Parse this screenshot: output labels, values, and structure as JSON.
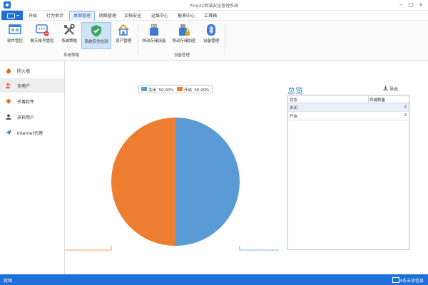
{
  "window": {
    "title": "Ping32终端安全管理系统"
  },
  "menu": {
    "tabs": [
      {
        "label": "开始"
      },
      {
        "label": "行为审计"
      },
      {
        "label": "桌面管理"
      },
      {
        "label": "网络管理"
      },
      {
        "label": "文档安全"
      },
      {
        "label": "运维中心"
      },
      {
        "label": "报表中心"
      },
      {
        "label": "工具箱"
      }
    ],
    "active_index": 2
  },
  "ribbon": {
    "groups": [
      {
        "label": "系统策略"
      },
      {
        "label": "设备管理"
      }
    ],
    "buttons": [
      {
        "label": "软件管控",
        "icon": "software-control-icon"
      },
      {
        "label": "聊天帐号管控",
        "icon": "chat-account-icon"
      },
      {
        "label": "系统策略",
        "icon": "tools-icon"
      },
      {
        "label": "系统安全检测",
        "icon": "shield-check-icon"
      },
      {
        "label": "资产管理",
        "icon": "asset-house-icon"
      },
      {
        "label": "移动存储设备",
        "icon": "usb-storage-icon"
      },
      {
        "label": "移动存储加密",
        "icon": "usb-encrypt-icon"
      },
      {
        "label": "设备管理",
        "icon": "bluetooth-device-icon"
      }
    ]
  },
  "sidebar": {
    "items": [
      {
        "label": "防火墙",
        "icon": "firewall-icon"
      },
      {
        "label": "多用户",
        "icon": "multi-user-icon"
      },
      {
        "label": "杀毒软件",
        "icon": "antivirus-icon"
      },
      {
        "label": "来宾用户",
        "icon": "guest-user-icon"
      },
      {
        "label": "Internet代理",
        "icon": "proxy-icon"
      }
    ],
    "active_index": 1
  },
  "chart_data": {
    "type": "pie",
    "categories": [
      "关闭",
      "开启"
    ],
    "values": [
      50,
      50
    ],
    "data_labels": [
      "50.00%",
      "50.00%"
    ],
    "legend": [
      {
        "name": "关闭",
        "percent": "50.00%",
        "color": "#5b9bd5"
      },
      {
        "name": "开启",
        "percent": "50.00%",
        "color": "#ed7d31"
      }
    ],
    "legend_placement": "top"
  },
  "overview": {
    "title": "总览",
    "export_label": "导出",
    "columns": [
      "状态",
      "终端数量"
    ],
    "rows": [
      {
        "status": "关闭",
        "count": "2"
      },
      {
        "status": "开启",
        "count": "2"
      }
    ]
  },
  "status": {
    "text": "就绪",
    "messages": "4条未读信息"
  },
  "colors": {
    "accent": "#1e6fd9",
    "pie_off": "#5b9bd5",
    "pie_on": "#ed7d31"
  }
}
